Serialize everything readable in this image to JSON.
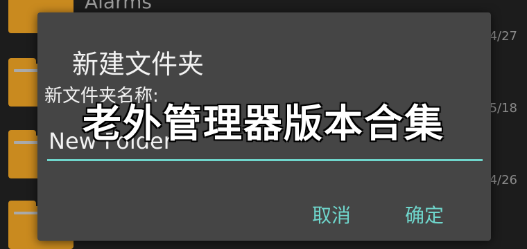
{
  "background": {
    "first_item_title": "Alarms",
    "dates": [
      "4/27",
      "5/18",
      "4/26"
    ]
  },
  "dialog": {
    "title": "新建文件夹",
    "field_label": "新文件夹名称:",
    "input_value": "New Folder",
    "cancel_label": "取消",
    "ok_label": "确定"
  },
  "overlay": {
    "caption": "老外管理器版本合集"
  },
  "colors": {
    "accent": "#6fd6cc",
    "folder": "#c98a1f",
    "dialog_bg": "#454545"
  }
}
